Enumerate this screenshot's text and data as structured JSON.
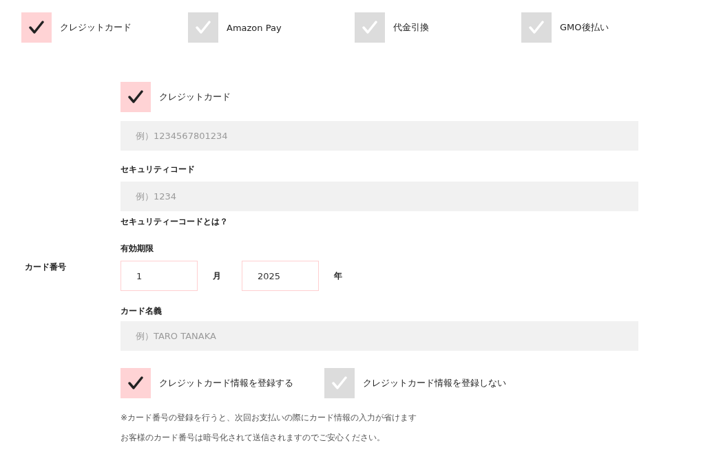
{
  "payment_methods": [
    {
      "label": "クレジットカード",
      "selected": true
    },
    {
      "label": "Amazon Pay",
      "selected": false
    },
    {
      "label": "代金引換",
      "selected": false
    },
    {
      "label": "GMO後払い",
      "selected": false
    }
  ],
  "card_section": {
    "label": "カード番号",
    "card_option": {
      "label": "クレジットカード",
      "selected": true
    },
    "card_number": {
      "placeholder": "例）1234567801234"
    },
    "security_code": {
      "label": "セキュリティコード",
      "placeholder": "例）1234"
    },
    "security_help": "セキュリティーコードとは？",
    "expiry": {
      "label": "有効期限",
      "month": "1",
      "month_unit": "月",
      "year": "2025",
      "year_unit": "年"
    },
    "card_holder": {
      "label": "カード名義",
      "placeholder": "例）TARO TANAKA"
    },
    "save_options": [
      {
        "label": "クレジットカード情報を登録する",
        "selected": true
      },
      {
        "label": "クレジットカード情報を登録しない",
        "selected": false
      }
    ],
    "notes": [
      "※カード番号の登録を行うと、次回お支払いの際にカード情報の入力が省けます",
      "お客様のカード番号は暗号化されて送信されますのでご安心ください。"
    ]
  }
}
